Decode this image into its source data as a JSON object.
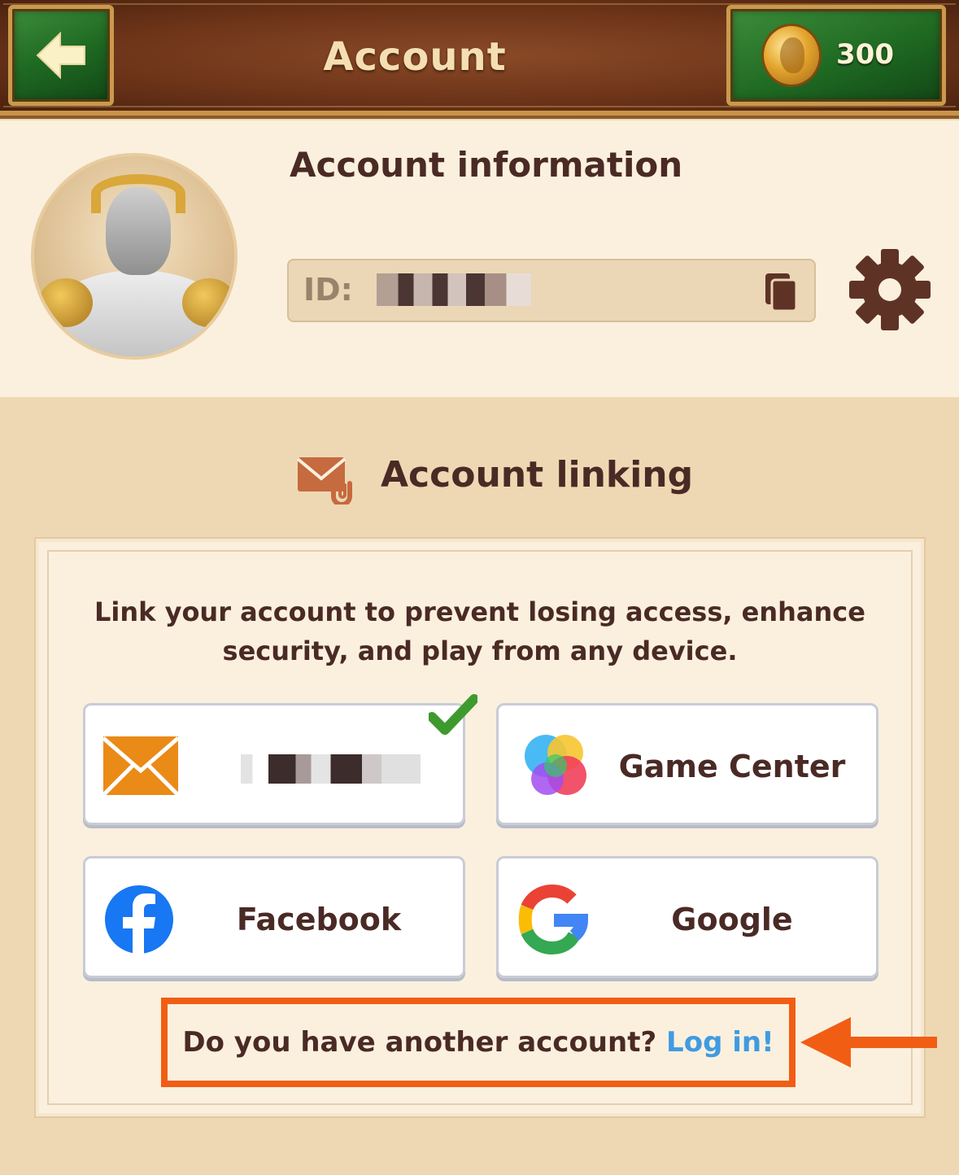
{
  "header": {
    "title": "Account",
    "back_icon": "arrow-left-icon",
    "coins": "300",
    "coin_icon": "gold-coin-icon"
  },
  "account_info": {
    "title": "Account information",
    "id_label": "ID:",
    "id_value": "■■■■■■",
    "copy_icon": "copy-icon",
    "settings_icon": "gear-icon"
  },
  "linking": {
    "title": "Account linking",
    "title_icon": "mail-clip-icon",
    "description": "Link your account to prevent losing access, enhance security, and play from any device.",
    "providers": [
      {
        "id": "email",
        "label": "■■■■■■",
        "icon": "envelope-icon",
        "linked": true
      },
      {
        "id": "game_center",
        "label": "Game Center",
        "icon": "game-center-icon",
        "linked": false
      },
      {
        "id": "facebook",
        "label": "Facebook",
        "icon": "facebook-icon",
        "linked": false
      },
      {
        "id": "google",
        "label": "Google",
        "icon": "google-icon",
        "linked": false
      }
    ],
    "login_prompt": "Do you have another account?",
    "login_link": "Log in!"
  },
  "colors": {
    "accent_orange": "#f25d14",
    "link_blue": "#3f9be2",
    "text_dark": "#4a2a25",
    "header_brown": "#6e3519",
    "button_green": "#1f6a23"
  }
}
